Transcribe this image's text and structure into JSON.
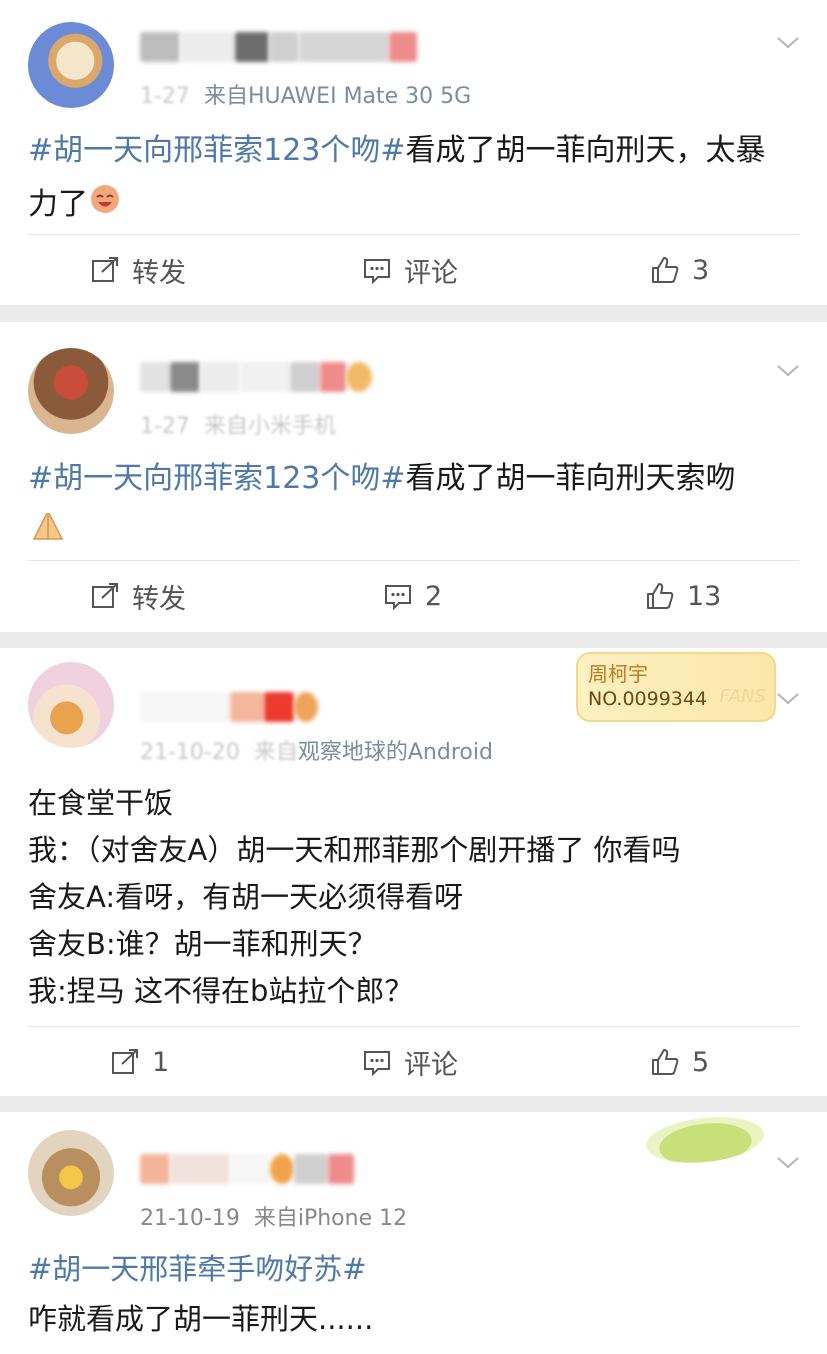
{
  "posts": [
    {
      "meta_time": "1-27",
      "meta_source": "来自HUAWEI Mate 30 5G",
      "hashtag": "#胡一天向邢菲索123个吻#",
      "body": "看成了胡一菲向刑天，太暴力了",
      "repost_label": "转发",
      "comment_label": "评论",
      "like_count": "3"
    },
    {
      "meta_time": "1-27",
      "meta_source": "来自小米手机",
      "hashtag": "#胡一天向邢菲索123个吻#",
      "body": "看成了胡一菲向刑天索吻",
      "repost_label": "转发",
      "comment_count": "2",
      "like_count": "13"
    },
    {
      "meta_time": "21-10-20",
      "meta_source": "来自",
      "meta_source_link": "观察地球的Android",
      "badge_name": "周柯宇",
      "badge_number": "NO.0099344",
      "badge_fans": "FANS",
      "lines": [
        "在食堂干饭",
        "我：（对舍友A）胡一天和邢菲那个剧开播了 你看吗",
        "舍友A:看呀，有胡一天必须得看呀",
        "舍友B:谁？胡一菲和刑天？",
        "我:捏马 这不得在b站拉个郎？"
      ],
      "repost_count": "1",
      "comment_label": "评论",
      "like_count": "5"
    },
    {
      "meta_time": "21-10-19",
      "meta_source": "来自iPhone 12",
      "hashtag": "#胡一天邢菲牵手吻好苏#",
      "body": "咋就看成了胡一菲刑天......"
    }
  ],
  "colors": {
    "hashtag": "#4e79a8",
    "meta": "#9aa0a6",
    "background": "#ebebeb"
  },
  "icons": [
    "chevron-down-icon",
    "repost-icon",
    "comment-icon",
    "like-icon"
  ]
}
